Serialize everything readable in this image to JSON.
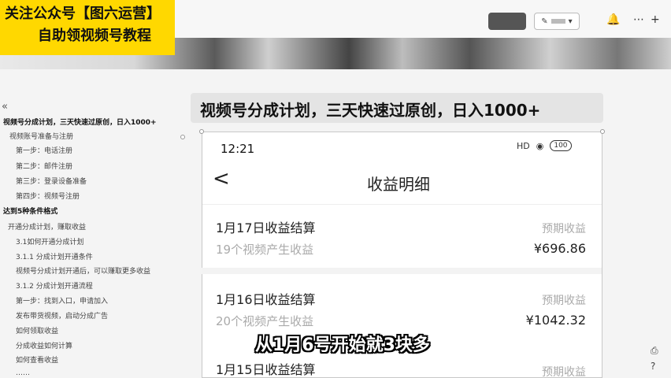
{
  "promo": {
    "line1": "关注公众号【图六运营】",
    "line2": "自助领视频号教程"
  },
  "toolbar": {
    "share_label": "▾",
    "icons": [
      "more-icon",
      "plus-icon"
    ]
  },
  "sidebar": {
    "collapse_glyph": "«",
    "items": [
      {
        "label": "视频号分成计划，三天快速过原创，日入1000+",
        "level": "h"
      },
      {
        "label": "视频账号准备与注册",
        "level": "1"
      },
      {
        "label": "第一步：电话注册",
        "level": "2"
      },
      {
        "label": "第二步：邮件注册",
        "level": "2"
      },
      {
        "label": "第三步：登录设备准备",
        "level": "2"
      },
      {
        "label": "第四步：视频号注册",
        "level": "2"
      },
      {
        "label": "达到5种条件格式",
        "level": "h"
      },
      {
        "label": "开通分成计划，赚取收益",
        "level": "1"
      },
      {
        "label": "3.1如何开通分成计划",
        "level": "2"
      },
      {
        "label": "3.1.1 分成计划开通条件",
        "level": "2"
      },
      {
        "label": "视频号分成计划开通后，可以赚取更多收益",
        "level": "1"
      },
      {
        "label": "3.1.2 分成计划开通流程",
        "level": "2"
      },
      {
        "label": "第一步：找到入口，申请加入",
        "level": "1"
      },
      {
        "label": "发布带货视频，启动分成广告",
        "level": "1"
      },
      {
        "label": "如何领取收益",
        "level": "1"
      },
      {
        "label": "分成收益如何计算",
        "level": "1"
      },
      {
        "label": "如何查看收益",
        "level": "1"
      },
      {
        "label": "……",
        "level": "1"
      }
    ]
  },
  "main": {
    "title": "视频号分成计划，三天快速过原创，日入1000+",
    "phone": {
      "time": "12:21",
      "status_hd": "HD",
      "battery": "100",
      "back_glyph": "<",
      "nav_title": "收益明细",
      "records": [
        {
          "title": "1月17日收益结算",
          "subtitle": "19个视频产生收益",
          "label": "预期收益",
          "amount": "¥696.86"
        },
        {
          "title": "1月16日收益结算",
          "subtitle": "20个视频产生收益",
          "label": "预期收益",
          "amount": "¥1042.32"
        },
        {
          "title": "1月15日收益结算",
          "subtitle": "",
          "label": "预期收益",
          "amount": ""
        }
      ]
    }
  },
  "subtitle": "从1月6号开始就3块多"
}
